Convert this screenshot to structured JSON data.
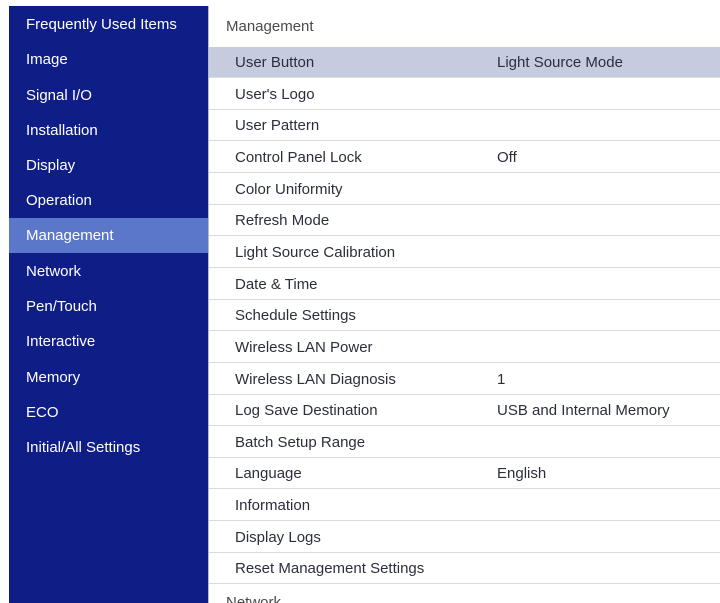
{
  "sidebar": {
    "items": [
      {
        "label": "Frequently Used Items"
      },
      {
        "label": "Image"
      },
      {
        "label": "Signal I/O"
      },
      {
        "label": "Installation"
      },
      {
        "label": "Display"
      },
      {
        "label": "Operation"
      },
      {
        "label": "Management",
        "selected": true
      },
      {
        "label": "Network"
      },
      {
        "label": "Pen/Touch"
      },
      {
        "label": "Interactive"
      },
      {
        "label": "Memory"
      },
      {
        "label": "ECO"
      },
      {
        "label": "Initial/All Settings"
      }
    ]
  },
  "main": {
    "header": "Management",
    "rows": [
      {
        "label": "User Button",
        "value": "Light Source Mode",
        "selected": true
      },
      {
        "label": "User's Logo",
        "value": ""
      },
      {
        "label": "User Pattern",
        "value": ""
      },
      {
        "label": "Control Panel Lock",
        "value": "Off"
      },
      {
        "label": "Color Uniformity",
        "value": ""
      },
      {
        "label": "Refresh Mode",
        "value": ""
      },
      {
        "label": "Light Source Calibration",
        "value": ""
      },
      {
        "label": "Date & Time",
        "value": ""
      },
      {
        "label": "Schedule Settings",
        "value": ""
      },
      {
        "label": "Wireless LAN Power",
        "value": ""
      },
      {
        "label": "Wireless LAN Diagnosis",
        "value": "1"
      },
      {
        "label": "Log Save Destination",
        "value": "USB and Internal Memory"
      },
      {
        "label": "Batch Setup Range",
        "value": ""
      },
      {
        "label": "Language",
        "value": "English"
      },
      {
        "label": "Information",
        "value": ""
      },
      {
        "label": "Display Logs",
        "value": ""
      },
      {
        "label": "Reset Management Settings",
        "value": ""
      }
    ],
    "next_section": "Network"
  },
  "colors": {
    "sidebar_bg": "#0f1e87",
    "sidebar_selected": "#5a77c9",
    "row_selected": "#c5cce0",
    "text": "#2b2f3b"
  }
}
